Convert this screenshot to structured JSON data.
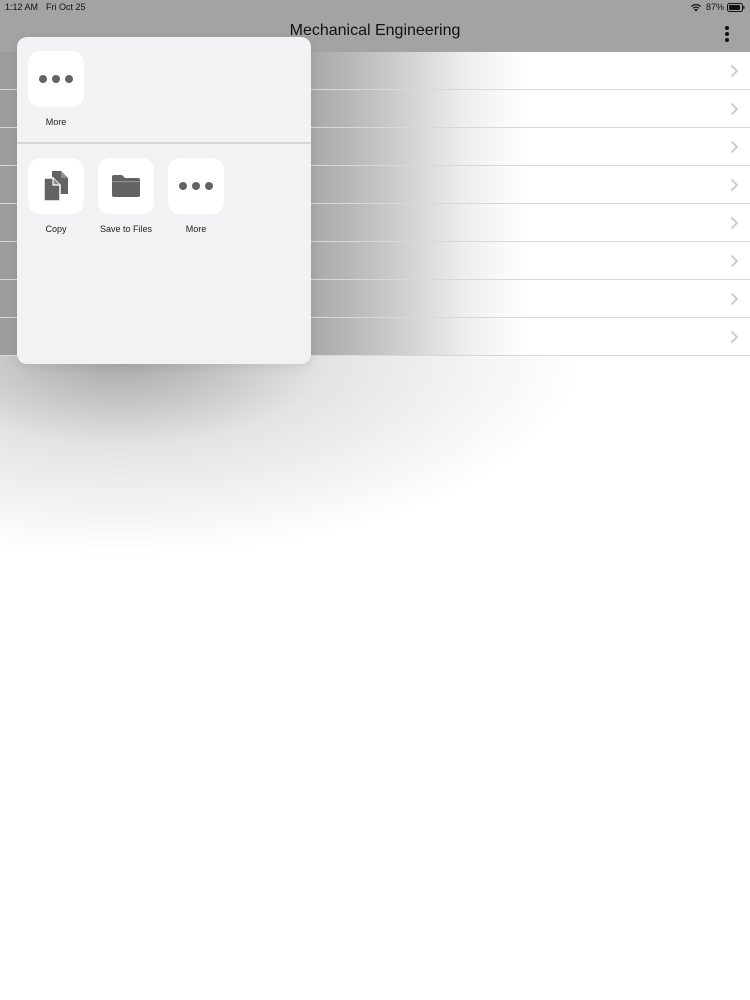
{
  "status_bar": {
    "time": "1:12 AM",
    "date": "Fri Oct 25",
    "battery_percent": "87%",
    "wifi_icon": "wifi-icon",
    "battery_icon": "battery-icon"
  },
  "nav": {
    "title": "Mechanical Engineering",
    "more_icon": "vertical-ellipsis-icon"
  },
  "list": {
    "row_count": 8,
    "chevron_icon": "chevron-right-icon"
  },
  "share_sheet": {
    "top_actions": [
      {
        "label": "More",
        "icon": "ellipsis-icon"
      }
    ],
    "bottom_actions": [
      {
        "label": "Copy",
        "icon": "copy-documents-icon"
      },
      {
        "label": "Save to Files",
        "icon": "folder-icon"
      },
      {
        "label": "More",
        "icon": "ellipsis-icon"
      }
    ]
  },
  "colors": {
    "overlay_gray": "#a3a3a3",
    "sheet_bg": "#f2f2f4",
    "icon_gray": "#636366"
  }
}
